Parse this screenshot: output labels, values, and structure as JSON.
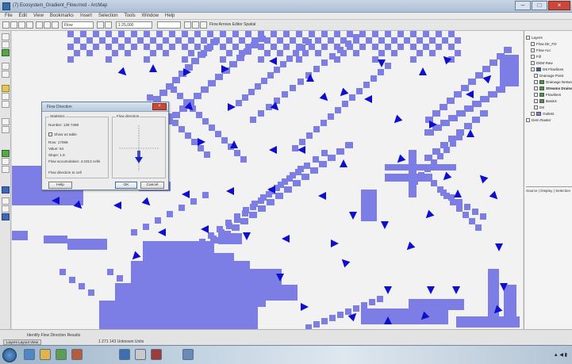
{
  "window": {
    "title": "(7) Ecosystem_Gradient_Flow.mxd - ArcMap"
  },
  "menubar": {
    "items": [
      "File",
      "Edit",
      "View",
      "Bookmarks",
      "Insert",
      "Selection",
      "Tools",
      "Window",
      "Help"
    ]
  },
  "toolbar": {
    "scale_value": "1:25,000",
    "layer_value": "Flow",
    "field_value": "",
    "label_text": "Flow Arrows  Editor  Spatial"
  },
  "colors": {
    "stream_fill": "#7d7de6",
    "arrow_fill": "#0e0ed0",
    "map_background": "#f2f2f2",
    "dialog_close": "#c8483a"
  },
  "dialog": {
    "title": "Flow Direction",
    "group_left": "Statistics",
    "group_right": "Flow direction",
    "field_1": "Number: 128 7488",
    "checkbox_label": "Show as table",
    "line_1": "Row: 17098",
    "line_2": "Value: 64",
    "line_3": "Slope: 1.8",
    "line_4": "Flow accumulation: 4.2313 cells",
    "line_5": "Flow direction to cell",
    "help_button": "Help",
    "ok_button": "OK",
    "cancel_button": "Cancel"
  },
  "toc": {
    "items": [
      {
        "label": "Layers",
        "bold": false,
        "swatch": ""
      },
      {
        "label": "Flow Dir_FD",
        "bold": false,
        "swatch": ""
      },
      {
        "label": "Flow Acc",
        "bold": false,
        "swatch": ""
      },
      {
        "label": "Fill",
        "bold": false,
        "swatch": ""
      },
      {
        "label": "DEM Raw",
        "bold": false,
        "swatch": ""
      },
      {
        "label": "D8 Flowlines",
        "bold": false,
        "swatch": "#3a5fb0"
      },
      {
        "label": "Drainage Point",
        "bold": false,
        "swatch": ""
      },
      {
        "label": "Drainage Network",
        "bold": false,
        "swatch": "#3f9f3f"
      },
      {
        "label": "Streams Drainage",
        "bold": true,
        "swatch": "#3f9f3f"
      },
      {
        "label": "Flowlines",
        "bold": false,
        "swatch": "#3f9f3f"
      },
      {
        "label": "Basins",
        "bold": false,
        "swatch": "#3f9f3f"
      },
      {
        "label": "D8",
        "bold": false,
        "swatch": ""
      },
      {
        "label": "Outlets",
        "bold": false,
        "swatch": "#7d7de6"
      },
      {
        "label": "Dem Raster",
        "bold": false,
        "swatch": ""
      }
    ],
    "footer": "Source | Display | Selection"
  },
  "statusbar": {
    "layer_tab": "Layers   Layout View",
    "text": "Identify   Flow Direction   Results",
    "coords": "1 271 143  Unknown Units"
  },
  "taskbar": {
    "icons": [
      "ie-icon",
      "folder-icon",
      "media-icon",
      "arcmap-icon",
      "app-icon",
      "app-icon",
      "app-icon",
      "app-icon"
    ]
  }
}
